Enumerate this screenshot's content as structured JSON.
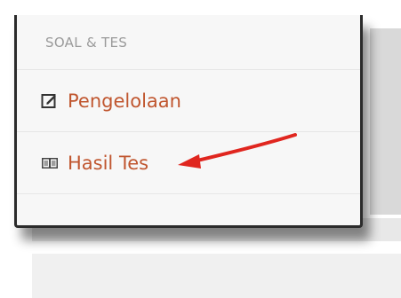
{
  "menu": {
    "section_title": "SOAL & TES",
    "items": [
      {
        "label": "Pengelolaan",
        "icon": "edit-icon"
      },
      {
        "label": "Hasil Tes",
        "icon": "book-icon"
      }
    ]
  },
  "annotation": {
    "type": "arrow",
    "color": "#e0261f"
  },
  "colors": {
    "item_text": "#c0562f",
    "header_text": "#9a9a9a",
    "menu_bg": "#f7f7f7"
  }
}
